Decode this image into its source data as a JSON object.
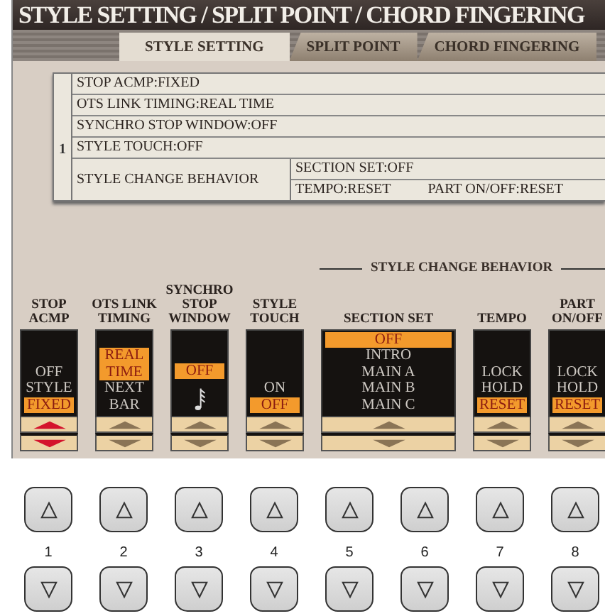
{
  "title": "STYLE SETTING / SPLIT POINT / CHORD FINGERING",
  "tabs": [
    {
      "label": "STYLE SETTING",
      "selected": true
    },
    {
      "label": "SPLIT POINT",
      "selected": false
    },
    {
      "label": "CHORD FINGERING",
      "selected": false
    }
  ],
  "settings_list": {
    "number": "1",
    "rows": [
      "STOP ACMP:FIXED",
      "OTS LINK TIMING:REAL TIME",
      "SYNCHRO STOP WINDOW:OFF",
      "STYLE TOUCH:OFF"
    ],
    "behavior": {
      "label": "STYLE CHANGE BEHAVIOR",
      "items": [
        [
          "SECTION SET:OFF"
        ],
        [
          "TEMPO:RESET",
          "PART ON/OFF:RESET"
        ]
      ]
    }
  },
  "group_label": "STYLE CHANGE BEHAVIOR",
  "columns": [
    {
      "label_lines": [
        "STOP",
        "ACMP"
      ],
      "active": true,
      "wide": false,
      "options": [
        {
          "text": "OFF",
          "selected": false
        },
        {
          "text": "STYLE",
          "selected": false
        },
        {
          "text": "FIXED",
          "selected": true
        }
      ]
    },
    {
      "label_lines": [
        "OTS LINK",
        "TIMING"
      ],
      "active": false,
      "wide": false,
      "options": [
        {
          "text": "REAL TIME",
          "selected": true
        },
        {
          "text": "NEXT BAR",
          "selected": false
        }
      ]
    },
    {
      "label_lines": [
        "SYNCHRO",
        "STOP",
        "WINDOW"
      ],
      "active": false,
      "wide": false,
      "options": [
        {
          "text": "OFF",
          "selected": true
        },
        {
          "kind": "note",
          "selected": false
        }
      ]
    },
    {
      "label_lines": [
        "STYLE",
        "TOUCH"
      ],
      "active": false,
      "wide": false,
      "options": [
        {
          "text": "ON",
          "selected": false
        },
        {
          "text": "OFF",
          "selected": true
        }
      ]
    },
    {
      "label_lines": [
        "SECTION SET"
      ],
      "active": false,
      "wide": true,
      "options": [
        {
          "text": "OFF",
          "selected": true
        },
        {
          "text": "INTRO",
          "selected": false
        },
        {
          "text": "MAIN A",
          "selected": false
        },
        {
          "text": "MAIN B",
          "selected": false
        },
        {
          "text": "MAIN C",
          "selected": false
        }
      ]
    },
    {
      "label_lines": [
        "TEMPO"
      ],
      "active": false,
      "wide": false,
      "options": [
        {
          "text": "LOCK",
          "selected": false
        },
        {
          "text": "HOLD",
          "selected": false
        },
        {
          "text": "RESET",
          "selected": true
        }
      ]
    },
    {
      "label_lines": [
        "PART",
        "ON/OFF"
      ],
      "active": false,
      "wide": false,
      "options": [
        {
          "text": "LOCK",
          "selected": false
        },
        {
          "text": "HOLD",
          "selected": false
        },
        {
          "text": "RESET",
          "selected": true
        }
      ]
    }
  ],
  "panel_buttons": [
    "1",
    "2",
    "3",
    "4",
    "5",
    "6",
    "7",
    "8"
  ]
}
